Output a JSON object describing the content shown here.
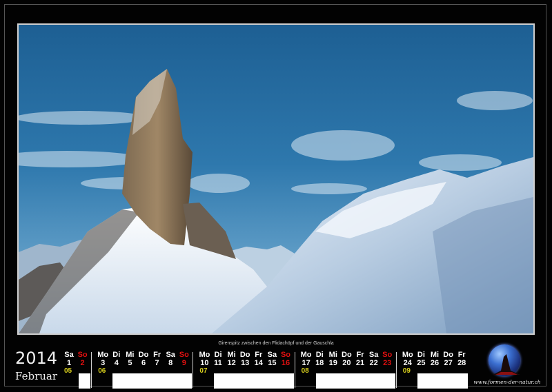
{
  "caption": "Girenspitz zwischen den Flidachöpf und der Gauschla",
  "year": "2014",
  "month": "Februar",
  "logo_url": "www.formen-der-natur.ch",
  "colors": {
    "weekend": "#e01010",
    "week_number": "#d8cf1d",
    "text": "#ffffff"
  },
  "calendar": {
    "days": [
      {
        "wd": "Sa",
        "d": "1",
        "red": false
      },
      {
        "wd": "So",
        "d": "2",
        "red": true
      },
      {
        "wd": "Mo",
        "d": "3",
        "red": false
      },
      {
        "wd": "Di",
        "d": "4",
        "red": false
      },
      {
        "wd": "Mi",
        "d": "5",
        "red": false
      },
      {
        "wd": "Do",
        "d": "6",
        "red": false
      },
      {
        "wd": "Fr",
        "d": "7",
        "red": false
      },
      {
        "wd": "Sa",
        "d": "8",
        "red": false
      },
      {
        "wd": "So",
        "d": "9",
        "red": true
      },
      {
        "wd": "Mo",
        "d": "10",
        "red": false
      },
      {
        "wd": "Di",
        "d": "11",
        "red": false
      },
      {
        "wd": "Mi",
        "d": "12",
        "red": false
      },
      {
        "wd": "Do",
        "d": "13",
        "red": false
      },
      {
        "wd": "Fr",
        "d": "14",
        "red": false
      },
      {
        "wd": "Sa",
        "d": "15",
        "red": false
      },
      {
        "wd": "So",
        "d": "16",
        "red": true
      },
      {
        "wd": "Mo",
        "d": "17",
        "red": false
      },
      {
        "wd": "Di",
        "d": "18",
        "red": false
      },
      {
        "wd": "Mi",
        "d": "19",
        "red": false
      },
      {
        "wd": "Do",
        "d": "20",
        "red": false
      },
      {
        "wd": "Fr",
        "d": "21",
        "red": false
      },
      {
        "wd": "Sa",
        "d": "22",
        "red": false
      },
      {
        "wd": "So",
        "d": "23",
        "red": true
      },
      {
        "wd": "Mo",
        "d": "24",
        "red": false
      },
      {
        "wd": "Di",
        "d": "25",
        "red": false
      },
      {
        "wd": "Mi",
        "d": "26",
        "red": false
      },
      {
        "wd": "Do",
        "d": "27",
        "red": false
      },
      {
        "wd": "Fr",
        "d": "28",
        "red": false
      }
    ],
    "weeks": [
      "05",
      "06",
      "07",
      "08",
      "09"
    ]
  }
}
